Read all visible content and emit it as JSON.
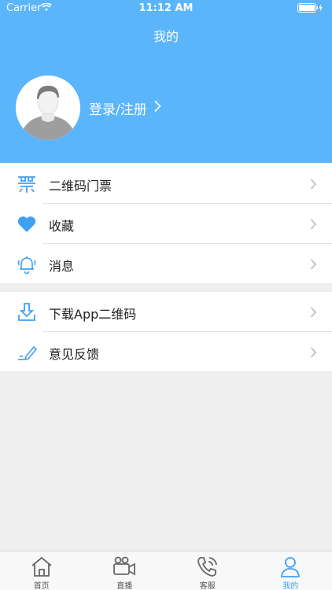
{
  "status_bar": {
    "carrier": "Carrier",
    "time": "11:12 AM"
  },
  "header": {
    "title": "我的",
    "login_label": "登录/注册"
  },
  "menu_group_1": [
    {
      "label": "二维码门票",
      "icon": "qr-ticket-icon"
    },
    {
      "label": "收藏",
      "icon": "heart-icon"
    },
    {
      "label": "消息",
      "icon": "bell-icon"
    }
  ],
  "menu_group_2": [
    {
      "label": "下载App二维码",
      "icon": "download-icon"
    },
    {
      "label": "意见反馈",
      "icon": "pencil-icon"
    }
  ],
  "tab_bar": [
    {
      "label": "首页",
      "icon": "home-icon",
      "active": false
    },
    {
      "label": "直播",
      "icon": "video-camera-icon",
      "active": false
    },
    {
      "label": "客服",
      "icon": "phone-icon",
      "active": false
    },
    {
      "label": "我的",
      "icon": "user-icon",
      "active": true
    }
  ],
  "colors": {
    "accent": "#5ab5fb",
    "tab_active": "#3da1f5",
    "icon_blue": "#3da1f5"
  }
}
